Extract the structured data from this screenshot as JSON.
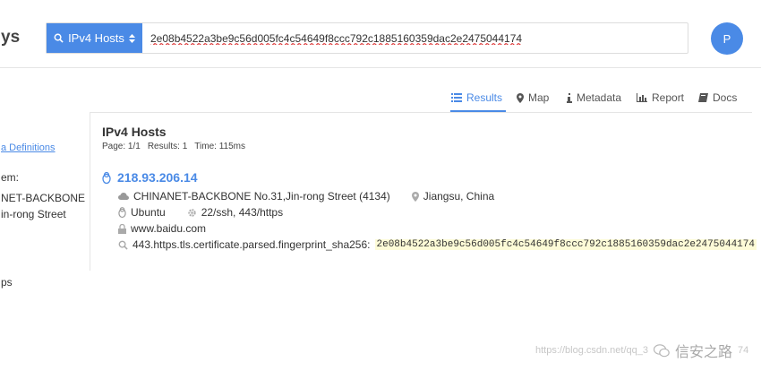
{
  "header": {
    "logo_fragment": "ys",
    "search_type_label": "IPv4 Hosts",
    "search_query": "2e08b4522a3be9c56d005fc4c54649f8ccc792c1885160359dac2e2475044174",
    "avatar_initial": "P"
  },
  "tabs": [
    {
      "label": "Results",
      "icon": "list-icon",
      "active": true
    },
    {
      "label": "Map",
      "icon": "map-pin-icon",
      "active": false
    },
    {
      "label": "Metadata",
      "icon": "info-icon",
      "active": false
    },
    {
      "label": "Report",
      "icon": "bar-chart-icon",
      "active": false
    },
    {
      "label": "Docs",
      "icon": "book-icon",
      "active": false
    }
  ],
  "sidebar": {
    "link_fragment": "a Definitions",
    "label_fragment": "em:",
    "line1": "NET-BACKBONE",
    "line2": "in-rong Street",
    "line3": "ps"
  },
  "results": {
    "title": "IPv4 Hosts",
    "page": "Page: 1/1",
    "count": "Results: 1",
    "time": "Time: 115ms"
  },
  "host": {
    "ip": "218.93.206.14",
    "network": "CHINANET-BACKBONE No.31,Jin-rong Street (4134)",
    "location": "Jiangsu, China",
    "os": "Ubuntu",
    "ports": "22/ssh, 443/https",
    "domain": "www.baidu.com",
    "match_field": "443.https.tls.certificate.parsed.fingerprint_sha256:",
    "match_value": "2e08b4522a3be9c56d005fc4c54649f8ccc792c1885160359dac2e2475044174"
  },
  "watermark": {
    "url": "https://blog.csdn.net/qq_3",
    "brand": "信安之路",
    "suffix": "74"
  },
  "colors": {
    "accent": "#4a8ae6",
    "highlight": "#fdfbd7"
  }
}
